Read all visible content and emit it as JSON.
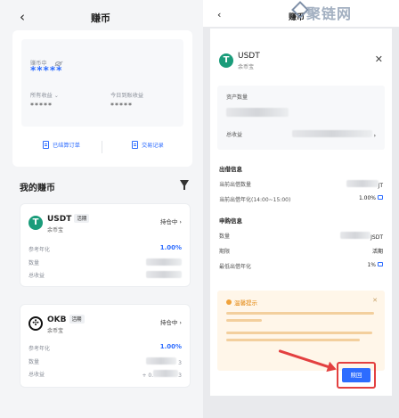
{
  "left": {
    "title": "赚币",
    "back": "‹",
    "summary": {
      "earning_label": "赚币中",
      "earning_value": "*****",
      "all_income_label": "所有收益 ⌄",
      "all_income_value": "*****",
      "today_income_label": "今日到账收益",
      "today_income_value": "*****",
      "settled_orders_label": "已结算订单",
      "trade_records_label": "交易记录"
    },
    "section_title": "我的赚币",
    "cards": [
      {
        "name": "USDT",
        "badge": "活期",
        "product": "余币宝",
        "status": "持仓中 ›",
        "ref_apr_label": "参考年化",
        "ref_apr_value": "1.00%",
        "amount_label": "数量",
        "total_income_label": "总收益",
        "icon_color": "#1a9c7a",
        "icon_glyph": "T"
      },
      {
        "name": "OKB",
        "badge": "活期",
        "product": "余币宝",
        "status": "持仓中 ›",
        "ref_apr_label": "参考年化",
        "ref_apr_value": "1.00%",
        "amount_label": "数量",
        "total_income_label": "总收益",
        "amount_tail": "3",
        "total_tail": "+ 0.",
        "total_tail_end": "3",
        "icon_color": "#111111",
        "icon_glyph": "✣"
      }
    ]
  },
  "right": {
    "back": "‹",
    "title": "赚币",
    "watermark": "聚链网",
    "sheet": {
      "coin": "USDT",
      "product": "余币宝",
      "close": "✕",
      "asset_amount_label": "资产数量",
      "total_income_label": "总收益",
      "total_income_arrow": "›",
      "lend_info_title": "出借信息",
      "lend_amount_label": "当前出借数量",
      "lend_amount_tail": "JT",
      "lend_apr_label": "当前出借年化(14:00~15:00)",
      "lend_apr_value": "1.00%",
      "apply_info_title": "申购信息",
      "apply_amount_label": "数量",
      "apply_amount_tail": "JSDT",
      "term_label": "期限",
      "term_value": "活期",
      "min_apr_label": "最低出借年化",
      "min_apr_value": "1%",
      "tip_title": "温馨提示",
      "tip_close": "✕",
      "redeem_label": "赎回"
    }
  }
}
